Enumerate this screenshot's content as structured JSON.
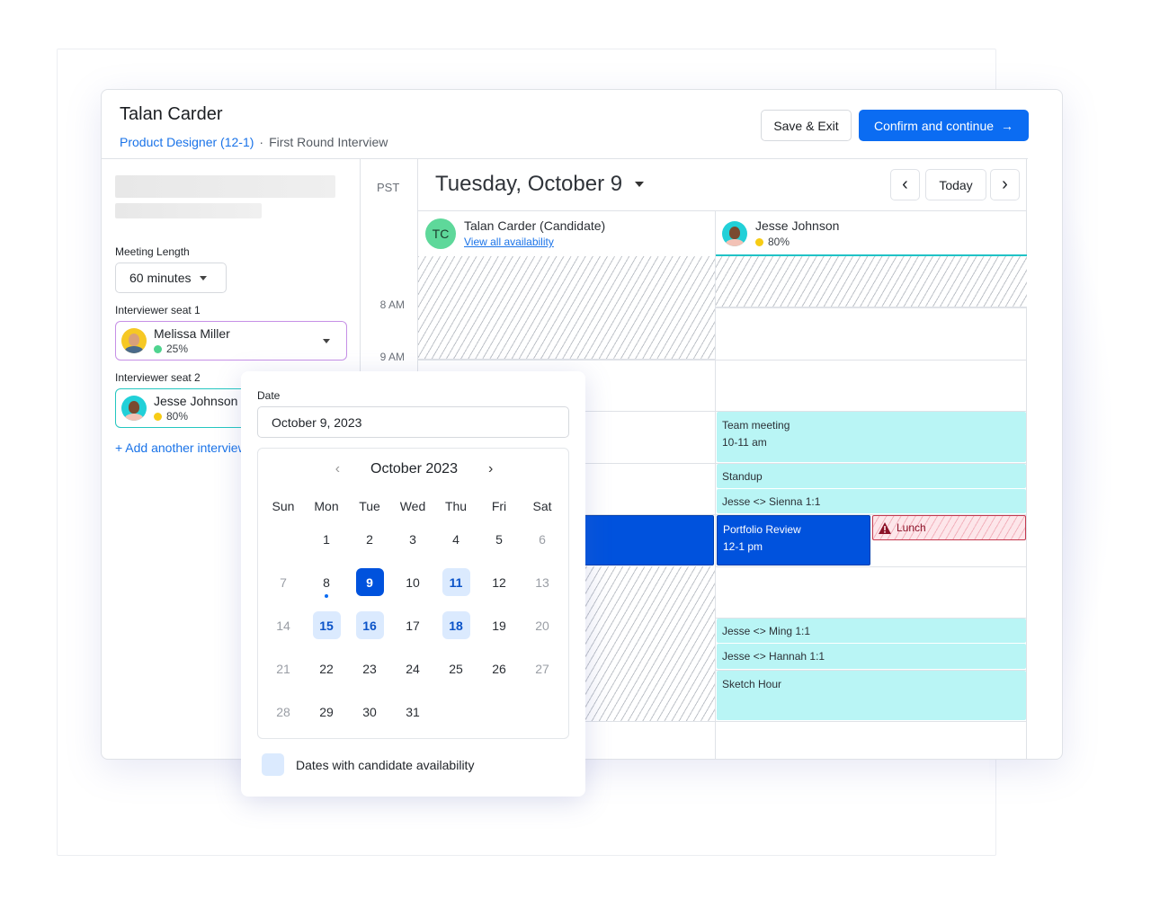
{
  "header": {
    "candidate_name": "Talan Carder",
    "job_title": "Product Designer (12-1)",
    "separator": "·",
    "stage": "First Round Interview",
    "save_exit_label": "Save & Exit",
    "confirm_label": "Confirm and continue",
    "confirm_icon": "→"
  },
  "sidebar": {
    "meeting_length_label": "Meeting Length",
    "meeting_length_value": "60 minutes",
    "seats": [
      {
        "label": "Interviewer seat 1",
        "name": "Melissa Miller",
        "load": "25%",
        "status_color": "#4fd48f"
      },
      {
        "label": "Interviewer seat 2",
        "name": "Jesse Johnson",
        "load": "80%",
        "status_color": "#f7cc15"
      }
    ],
    "add_interviewer_label": "+ Add another interviewer"
  },
  "calendar": {
    "timezone": "PST",
    "time_labels": [
      "8 AM",
      "9 AM"
    ],
    "date_title": "Tuesday, October 9",
    "prev_icon": "‹",
    "today_label": "Today",
    "next_icon": "›",
    "candidate": {
      "initials": "TC",
      "name": "Talan Carder (Candidate)",
      "link": "View all availability"
    },
    "interviewer": {
      "name": "Jesse Johnson",
      "load": "80%"
    },
    "events": [
      {
        "title": "Team meeting",
        "time": "10-11 am"
      },
      {
        "title": "Standup",
        "time": ""
      },
      {
        "title": "Jesse <> Sienna 1:1",
        "time": ""
      },
      {
        "title": "Portfolio Review",
        "time": "12-1 pm"
      },
      {
        "title": "Lunch",
        "time": "",
        "warning": true
      },
      {
        "title": "Jesse <> Ming 1:1",
        "time": ""
      },
      {
        "title": "Jesse <> Hannah 1:1",
        "time": ""
      },
      {
        "title": "Sketch Hour",
        "time": ""
      }
    ]
  },
  "datepicker": {
    "label": "Date",
    "value": "October 9, 2023",
    "month_title": "October 2023",
    "weekdays": [
      "Sun",
      "Mon",
      "Tue",
      "Wed",
      "Thu",
      "Fri",
      "Sat"
    ],
    "days": [
      "1",
      "2",
      "3",
      "4",
      "5",
      "6",
      "7",
      "8",
      "9",
      "10",
      "11",
      "12",
      "13",
      "14",
      "15",
      "16",
      "17",
      "18",
      "19",
      "20",
      "21",
      "22",
      "23",
      "24",
      "25",
      "26",
      "27",
      "28",
      "29",
      "30",
      "31"
    ],
    "selected_day": 9,
    "today_day": 8,
    "available_days": [
      11,
      15,
      16,
      18
    ],
    "legend": "Dates with candidate availability"
  }
}
